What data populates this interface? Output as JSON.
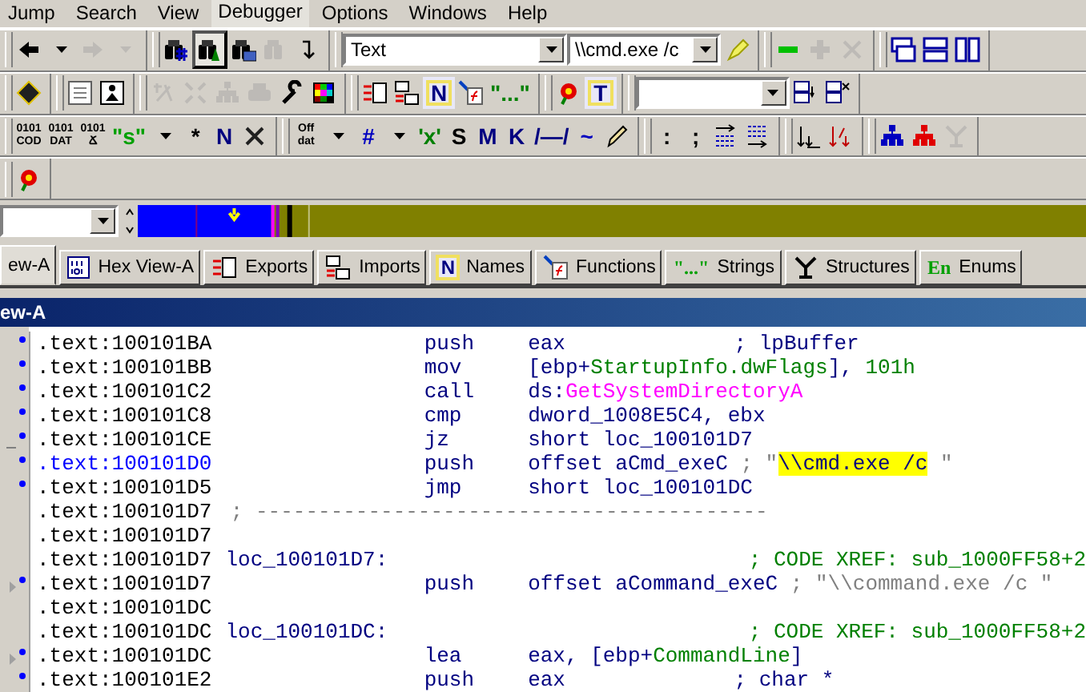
{
  "menu": [
    {
      "label": "Jump",
      "selected": false
    },
    {
      "label": "Search",
      "selected": false
    },
    {
      "label": "View",
      "selected": false
    },
    {
      "label": "Debugger",
      "selected": true
    },
    {
      "label": "Options",
      "selected": false
    },
    {
      "label": "Windows",
      "selected": false
    },
    {
      "label": "Help",
      "selected": false
    }
  ],
  "toolbars": [
    {
      "groups": [
        {
          "items": [
            {
              "kind": "back",
              "disabled": false
            },
            {
              "kind": "caret",
              "disabled": false
            },
            {
              "kind": "forward",
              "disabled": true
            },
            {
              "kind": "caret",
              "disabled": true
            }
          ]
        },
        {
          "items": [
            {
              "kind": "findhash",
              "disabled": false,
              "pressed": false
            },
            {
              "kind": "findtext",
              "disabled": false,
              "pressed": true
            },
            {
              "kind": "findbytes",
              "disabled": false,
              "pressed": false
            },
            {
              "kind": "find",
              "disabled": true,
              "pressed": false
            },
            {
              "kind": "jump",
              "disabled": false,
              "pressed": false
            }
          ]
        },
        {
          "items": [
            {
              "kind": "combo",
              "value": "Text"
            },
            {
              "kind": "combo",
              "value": "\\\\cmd.exe /c"
            },
            {
              "kind": "highlighter",
              "disabled": false
            }
          ]
        },
        {
          "items": [
            {
              "kind": "minus",
              "disabled": false
            },
            {
              "kind": "plus",
              "disabled": true
            },
            {
              "kind": "cross",
              "disabled": true
            }
          ]
        },
        {
          "items": [
            {
              "kind": "cascade",
              "disabled": false
            },
            {
              "kind": "tile",
              "disabled": false
            },
            {
              "kind": "columns",
              "disabled": false
            }
          ]
        }
      ]
    },
    {
      "groups": [
        {
          "items": [
            {
              "kind": "chip",
              "disabled": false
            }
          ]
        },
        {
          "items": [
            {
              "kind": "memo",
              "disabled": false
            },
            {
              "kind": "person",
              "disabled": false
            }
          ]
        },
        {
          "items": [
            {
              "kind": "zoom",
              "disabled": true
            },
            {
              "kind": "collapse",
              "disabled": true
            },
            {
              "kind": "tree",
              "disabled": true
            },
            {
              "kind": "printer",
              "disabled": true
            },
            {
              "kind": "wrench",
              "disabled": false
            },
            {
              "kind": "palette",
              "disabled": false
            }
          ]
        },
        {
          "items": [
            {
              "kind": "exports",
              "disabled": false
            },
            {
              "kind": "imports",
              "disabled": false
            },
            {
              "kind": "boxglyph",
              "text": "N",
              "color": "#000080"
            },
            {
              "kind": "function",
              "disabled": false
            },
            {
              "kind": "glyph",
              "text": "\"...\"",
              "color": "#008000"
            }
          ]
        },
        {
          "items": [
            {
              "kind": "flower",
              "disabled": false
            },
            {
              "kind": "boxglyph",
              "text": "T",
              "color": "#000080"
            }
          ]
        },
        {
          "items": [
            {
              "kind": "combo",
              "value": ""
            },
            {
              "kind": "windowadd",
              "disabled": false
            },
            {
              "kind": "windowdel",
              "disabled": false
            }
          ]
        }
      ]
    },
    {
      "groups": [
        {
          "items": [
            {
              "kind": "stack",
              "lines": [
                "0101",
                "COD"
              ]
            },
            {
              "kind": "stack",
              "lines": [
                "0101",
                "DAT"
              ]
            },
            {
              "kind": "stack",
              "lines": [
                "0101",
                "Ճ"
              ]
            },
            {
              "kind": "glyph",
              "text": "\"s\"",
              "color": "#00a000"
            },
            {
              "kind": "caret",
              "disabled": false
            },
            {
              "kind": "glyph",
              "text": "*",
              "color": "#000000"
            },
            {
              "kind": "glyph",
              "text": "N",
              "color": "#000080"
            },
            {
              "kind": "cross",
              "disabled": false
            }
          ]
        },
        {
          "items": [
            {
              "kind": "stack",
              "lines": [
                "Off",
                "dat"
              ]
            },
            {
              "kind": "caret",
              "disabled": false
            },
            {
              "kind": "glyph",
              "text": "#",
              "color": "#0000c0"
            },
            {
              "kind": "caret",
              "disabled": false
            },
            {
              "kind": "glyph",
              "text": "'x'",
              "color": "#008000"
            },
            {
              "kind": "glyph",
              "text": "S",
              "color": "#000000"
            },
            {
              "kind": "glyph",
              "text": "M",
              "color": "#000080"
            },
            {
              "kind": "glyph",
              "text": "K",
              "color": "#000080"
            },
            {
              "kind": "glyph",
              "text": "/—/",
              "color": "#000080"
            },
            {
              "kind": "glyph",
              "text": "~",
              "color": "#0000c0"
            },
            {
              "kind": "pencil",
              "disabled": false
            }
          ]
        },
        {
          "items": [
            {
              "kind": "glyph",
              "text": ":",
              "color": "#000000"
            },
            {
              "kind": "glyph",
              "text": ";",
              "color": "#000000"
            },
            {
              "kind": "sortdown",
              "disabled": false
            },
            {
              "kind": "sortup",
              "disabled": false
            }
          ]
        },
        {
          "items": [
            {
              "kind": "xrefs",
              "disabled": false
            },
            {
              "kind": "xrefsx",
              "disabled": false
            }
          ]
        },
        {
          "items": [
            {
              "kind": "tree",
              "disabled": false
            },
            {
              "kind": "redtree",
              "disabled": false
            },
            {
              "kind": "graph",
              "disabled": true
            }
          ]
        }
      ]
    },
    {
      "groups": [
        {
          "items": [
            {
              "kind": "flower",
              "disabled": false
            }
          ]
        }
      ]
    }
  ],
  "tabs": [
    {
      "kind": "disasm",
      "label": "ew-A",
      "selected": true
    },
    {
      "kind": "hex",
      "label": "Hex View-A",
      "selected": false
    },
    {
      "kind": "exports",
      "label": "Exports",
      "selected": false
    },
    {
      "kind": "imports",
      "label": "Imports",
      "selected": false
    },
    {
      "kind": "names",
      "glyph": "N",
      "label": "Names",
      "selected": false
    },
    {
      "kind": "functions",
      "label": "Functions",
      "selected": false
    },
    {
      "kind": "strings",
      "glyph": "\"...\"",
      "label": "Strings",
      "selected": false
    },
    {
      "kind": "structures",
      "label": "Structures",
      "selected": false
    },
    {
      "kind": "enums",
      "glyph": "En",
      "label": "Enums",
      "selected": false
    }
  ],
  "view": {
    "title": "ew-A",
    "lines": [
      {
        "kind": "insn",
        "dot": true,
        "arrow": false,
        "dash": false,
        "address": ".text:100101BA",
        "selected": false,
        "mnemonic": "push",
        "operands": [
          {
            "kind": "plain",
            "text": "eax"
          }
        ],
        "comment": [
          {
            "kind": "auto",
            "text": "; lpBuffer"
          }
        ]
      },
      {
        "kind": "insn",
        "dot": true,
        "arrow": false,
        "dash": false,
        "address": ".text:100101BB",
        "selected": false,
        "mnemonic": "mov",
        "operands": [
          {
            "kind": "plain",
            "text": "[ebp+"
          },
          {
            "kind": "member",
            "text": "StartupInfo.dwFlags"
          },
          {
            "kind": "plain",
            "text": "], "
          },
          {
            "kind": "number",
            "text": "101h"
          }
        ]
      },
      {
        "kind": "insn",
        "dot": true,
        "arrow": false,
        "dash": false,
        "address": ".text:100101C2",
        "selected": false,
        "mnemonic": "call",
        "operands": [
          {
            "kind": "plain",
            "text": "ds:"
          },
          {
            "kind": "import",
            "text": "GetSystemDirectoryA"
          }
        ]
      },
      {
        "kind": "insn",
        "dot": true,
        "arrow": false,
        "dash": false,
        "address": ".text:100101C8",
        "selected": false,
        "mnemonic": "cmp",
        "operands": [
          {
            "kind": "plain",
            "text": "dword_1008E5C4, ebx"
          }
        ]
      },
      {
        "kind": "insn",
        "dot": true,
        "arrow": false,
        "dash": true,
        "address": ".text:100101CE",
        "selected": false,
        "mnemonic": "jz",
        "operands": [
          {
            "kind": "plain",
            "text": "short loc_100101D7"
          }
        ]
      },
      {
        "kind": "insn",
        "dot": true,
        "arrow": false,
        "dash": false,
        "address": ".text:100101D0",
        "selected": true,
        "mnemonic": "push",
        "operands": [
          {
            "kind": "plain",
            "text": "offset aCmd_exeC"
          }
        ],
        "comment": [
          {
            "kind": "string",
            "text": "; \""
          },
          {
            "kind": "match",
            "text": "\\\\cmd.exe /c"
          },
          {
            "kind": "string",
            "text": " \""
          }
        ]
      },
      {
        "kind": "insn",
        "dot": true,
        "arrow": false,
        "dash": false,
        "address": ".text:100101D5",
        "selected": false,
        "mnemonic": "jmp",
        "operands": [
          {
            "kind": "plain",
            "text": "short loc_100101DC"
          }
        ]
      },
      {
        "kind": "separator",
        "dot": false,
        "arrow": false,
        "dash": false,
        "address": ".text:100101D7",
        "selected": false,
        "comment": [
          {
            "kind": "string",
            "text": "; -----------------------------------------"
          }
        ]
      },
      {
        "kind": "blank",
        "dot": false,
        "arrow": false,
        "dash": false,
        "address": ".text:100101D7",
        "selected": false
      },
      {
        "kind": "label",
        "dot": false,
        "arrow": false,
        "dash": false,
        "address": ".text:100101D7",
        "selected": false,
        "label": "loc_100101D7:",
        "comment": [
          {
            "kind": "xref",
            "text": "; CODE XREF: sub_1000FF58+2"
          }
        ]
      },
      {
        "kind": "insn",
        "dot": true,
        "arrow": true,
        "dash": false,
        "address": ".text:100101D7",
        "selected": false,
        "mnemonic": "push",
        "operands": [
          {
            "kind": "plain",
            "text": "offset aCommand_exeC"
          }
        ],
        "comment": [
          {
            "kind": "string",
            "text": "; \"\\\\command.exe /c \""
          }
        ]
      },
      {
        "kind": "blank",
        "dot": false,
        "arrow": false,
        "dash": false,
        "address": ".text:100101DC",
        "selected": false
      },
      {
        "kind": "label",
        "dot": false,
        "arrow": false,
        "dash": false,
        "address": ".text:100101DC",
        "selected": false,
        "label": "loc_100101DC:",
        "comment": [
          {
            "kind": "xref",
            "text": "; CODE XREF: sub_1000FF58+2"
          }
        ]
      },
      {
        "kind": "insn",
        "dot": true,
        "arrow": true,
        "dash": false,
        "address": ".text:100101DC",
        "selected": false,
        "mnemonic": "lea",
        "operands": [
          {
            "kind": "plain",
            "text": "eax, [ebp+"
          },
          {
            "kind": "member",
            "text": "CommandLine"
          },
          {
            "kind": "plain",
            "text": "]"
          }
        ]
      },
      {
        "kind": "insn",
        "dot": true,
        "arrow": false,
        "dash": false,
        "address": ".text:100101E2",
        "selected": false,
        "mnemonic": "push",
        "operands": [
          {
            "kind": "plain",
            "text": "eax"
          }
        ],
        "comment": [
          {
            "kind": "auto",
            "text": "; char *"
          }
        ]
      }
    ]
  }
}
